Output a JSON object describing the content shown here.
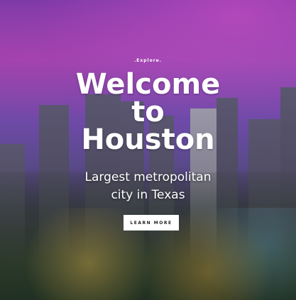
{
  "hero": {
    "eyebrow": ".Explore.",
    "title_line1": "Welcome",
    "title_line2": "to",
    "title_line3": "Houston",
    "subtitle_line1": "Largest metropolitan",
    "subtitle_line2": "city in Texas",
    "cta_label": "LEARN MORE"
  }
}
